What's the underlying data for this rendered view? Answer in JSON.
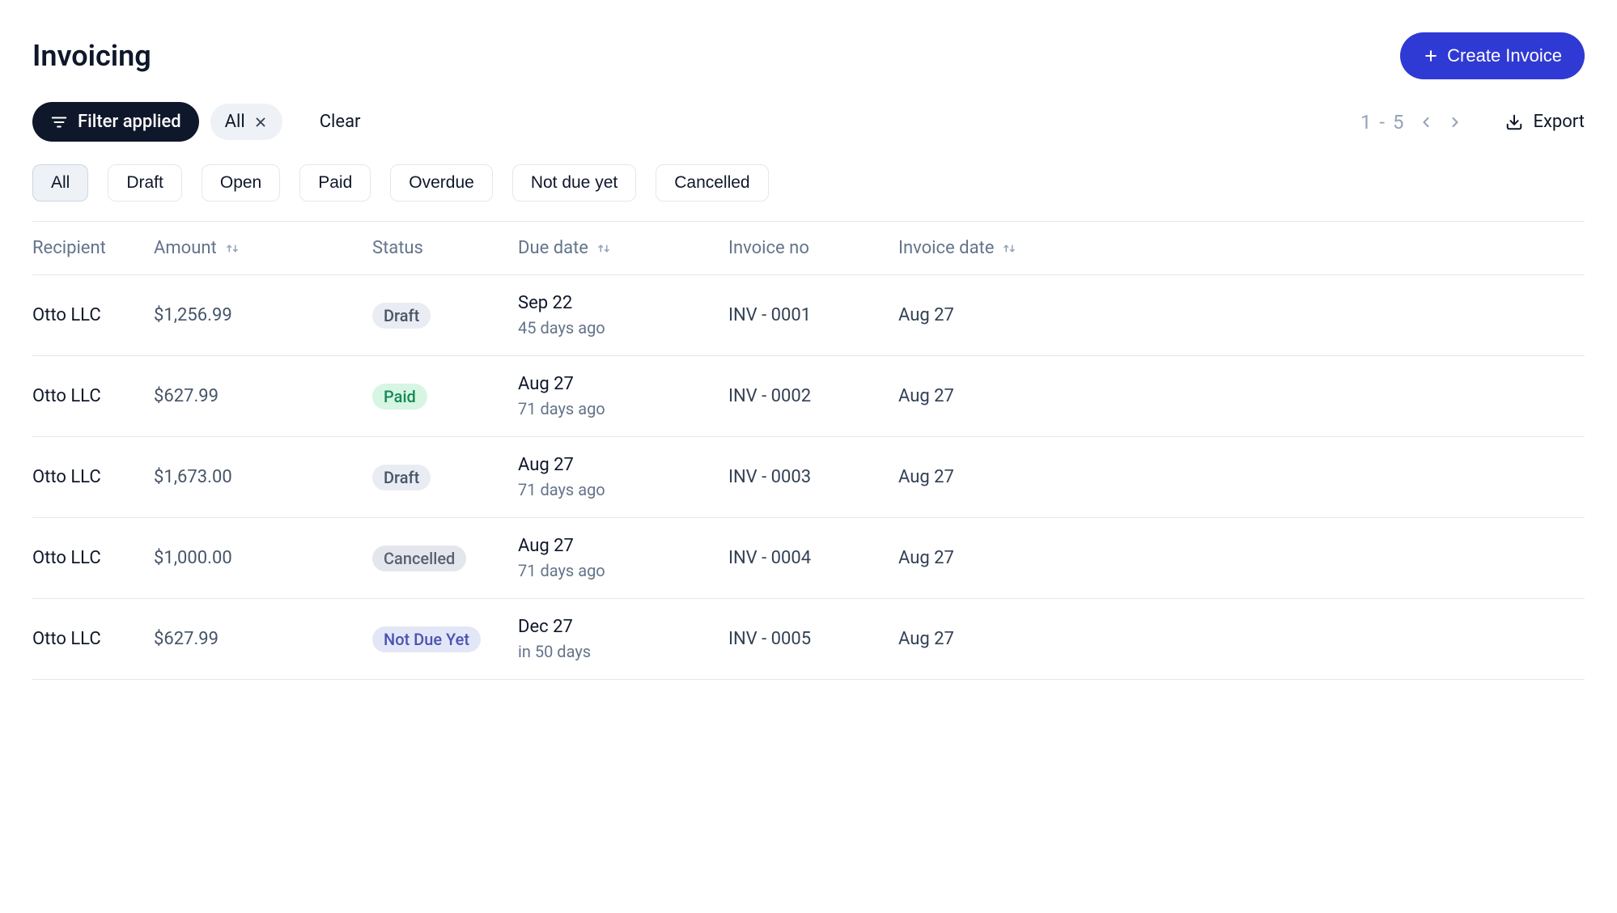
{
  "header": {
    "title": "Invoicing",
    "create_label": "Create Invoice"
  },
  "toolbar": {
    "filter_label": "Filter applied",
    "all_chip": "All",
    "clear_label": "Clear",
    "page_label": "1 - 5",
    "export_label": "Export"
  },
  "tabs": [
    "All",
    "Draft",
    "Open",
    "Paid",
    "Overdue",
    "Not due yet",
    "Cancelled"
  ],
  "table": {
    "headers": {
      "recipient": "Recipient",
      "amount": "Amount",
      "status": "Status",
      "due_date": "Due date",
      "invoice_no": "Invoice no",
      "invoice_date": "Invoice date"
    },
    "rows": [
      {
        "recipient": "Otto LLC",
        "amount": "$1,256.99",
        "status": "Draft",
        "status_type": "draft",
        "due_date": "Sep 22",
        "due_ago": "45 days ago",
        "invoice_no": "INV - 0001",
        "invoice_date": "Aug 27"
      },
      {
        "recipient": "Otto LLC",
        "amount": "$627.99",
        "status": "Paid",
        "status_type": "paid",
        "due_date": "Aug 27",
        "due_ago": "71 days ago",
        "invoice_no": "INV - 0002",
        "invoice_date": "Aug 27"
      },
      {
        "recipient": "Otto LLC",
        "amount": "$1,673.00",
        "status": "Draft",
        "status_type": "draft",
        "due_date": "Aug 27",
        "due_ago": "71 days ago",
        "invoice_no": "INV - 0003",
        "invoice_date": "Aug 27"
      },
      {
        "recipient": "Otto LLC",
        "amount": "$1,000.00",
        "status": "Cancelled",
        "status_type": "cancelled",
        "due_date": "Aug 27",
        "due_ago": "71 days ago",
        "invoice_no": "INV - 0004",
        "invoice_date": "Aug 27"
      },
      {
        "recipient": "Otto LLC",
        "amount": "$627.99",
        "status": "Not Due Yet",
        "status_type": "notdue",
        "due_date": "Dec 27",
        "due_ago": "in 50 days",
        "invoice_no": "INV - 0005",
        "invoice_date": "Aug 27"
      }
    ]
  }
}
